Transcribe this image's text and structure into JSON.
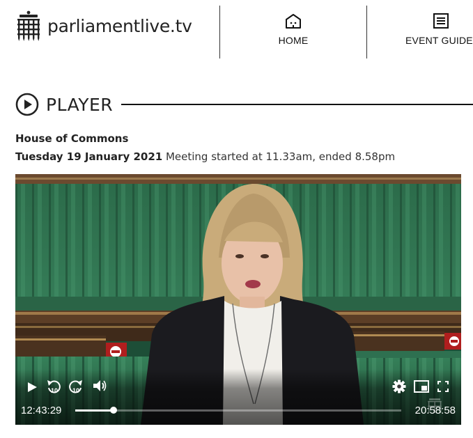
{
  "header": {
    "site_name": "parliamentlive.tv",
    "nav": [
      {
        "label": "HOME",
        "icon": "home-icon"
      },
      {
        "label": "EVENT GUIDE",
        "icon": "event-guide-icon"
      }
    ]
  },
  "player": {
    "heading": "PLAYER",
    "house": "House of Commons",
    "date": "Tuesday 19 January 2021",
    "meeting": "Meeting started at 11.33am, ended 8.58pm"
  },
  "video": {
    "current_time": "12:43:29",
    "total_time": "20:58:58",
    "progress_fraction": 0.117,
    "skip_back_seconds": "10",
    "skip_forward_seconds": "10",
    "controls": [
      "play-icon",
      "rewind-10-icon",
      "forward-10-icon",
      "volume-icon",
      "settings-gear-icon",
      "picture-in-picture-icon",
      "fullscreen-icon"
    ]
  },
  "colors": {
    "bench_green": "#2f7a55",
    "text_dark": "#222222",
    "control_white": "#ffffff"
  }
}
